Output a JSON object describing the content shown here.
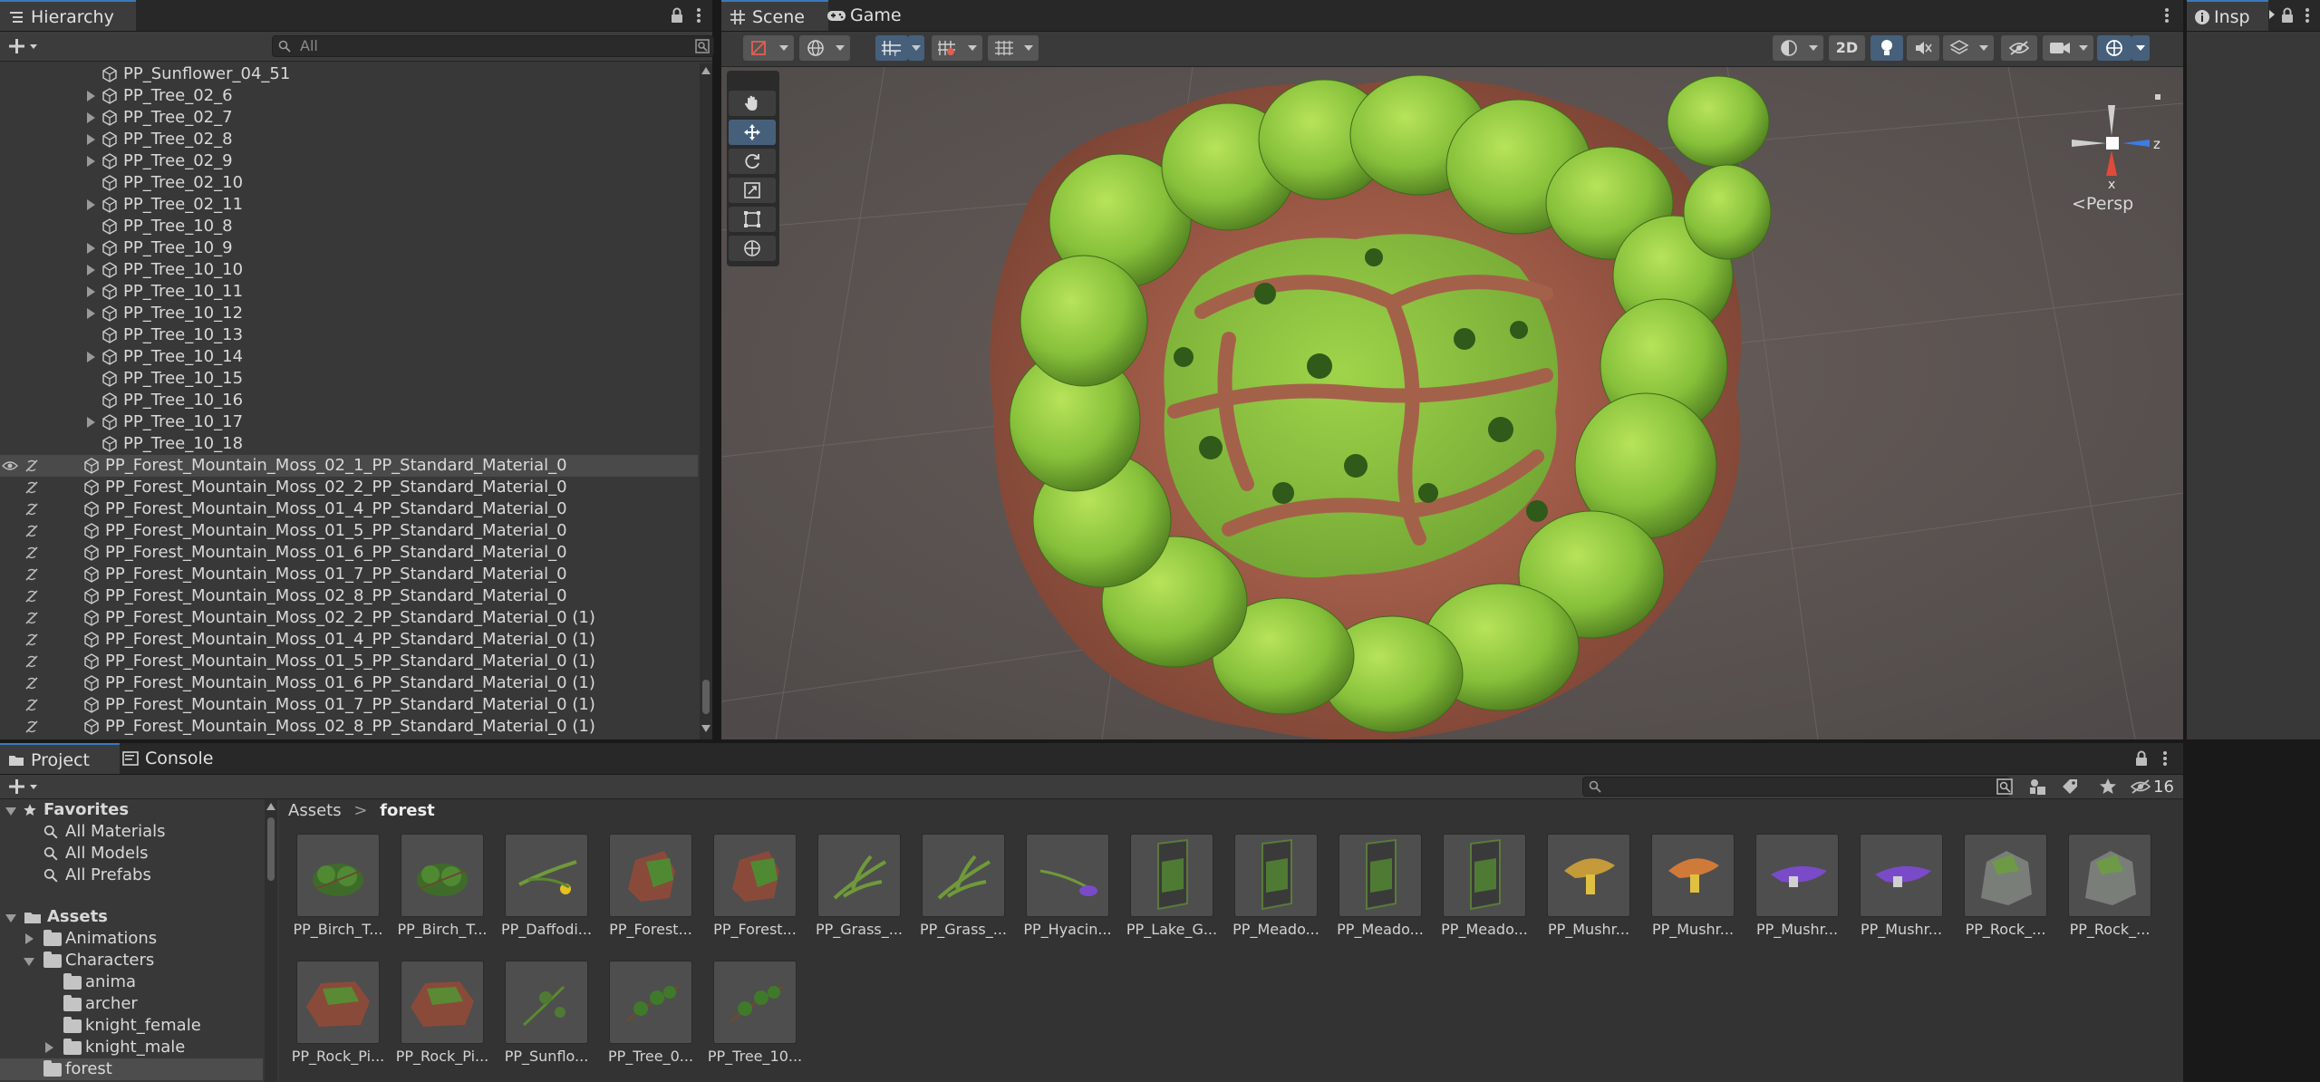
{
  "hierarchy": {
    "tab_label": "Hierarchy",
    "search_placeholder": "All",
    "rows": [
      {
        "label": "PP_Sunflower_04_51",
        "arrow": false,
        "top_level": false
      },
      {
        "label": "PP_Tree_02_6",
        "arrow": true,
        "top_level": false
      },
      {
        "label": "PP_Tree_02_7",
        "arrow": true,
        "top_level": false
      },
      {
        "label": "PP_Tree_02_8",
        "arrow": true,
        "top_level": false
      },
      {
        "label": "PP_Tree_02_9",
        "arrow": true,
        "top_level": false
      },
      {
        "label": "PP_Tree_02_10",
        "arrow": false,
        "top_level": false
      },
      {
        "label": "PP_Tree_02_11",
        "arrow": true,
        "top_level": false
      },
      {
        "label": "PP_Tree_10_8",
        "arrow": false,
        "top_level": false
      },
      {
        "label": "PP_Tree_10_9",
        "arrow": true,
        "top_level": false
      },
      {
        "label": "PP_Tree_10_10",
        "arrow": true,
        "top_level": false
      },
      {
        "label": "PP_Tree_10_11",
        "arrow": true,
        "top_level": false
      },
      {
        "label": "PP_Tree_10_12",
        "arrow": true,
        "top_level": false
      },
      {
        "label": "PP_Tree_10_13",
        "arrow": false,
        "top_level": false
      },
      {
        "label": "PP_Tree_10_14",
        "arrow": true,
        "top_level": false
      },
      {
        "label": "PP_Tree_10_15",
        "arrow": false,
        "top_level": false
      },
      {
        "label": "PP_Tree_10_16",
        "arrow": false,
        "top_level": false
      },
      {
        "label": "PP_Tree_10_17",
        "arrow": true,
        "top_level": false
      },
      {
        "label": "PP_Tree_10_18",
        "arrow": false,
        "top_level": false
      },
      {
        "label": "PP_Forest_Mountain_Moss_02_1_PP_Standard_Material_0",
        "arrow": false,
        "top_level": true,
        "selected": true
      },
      {
        "label": "PP_Forest_Mountain_Moss_02_2_PP_Standard_Material_0",
        "arrow": false,
        "top_level": true
      },
      {
        "label": "PP_Forest_Mountain_Moss_01_4_PP_Standard_Material_0",
        "arrow": false,
        "top_level": true
      },
      {
        "label": "PP_Forest_Mountain_Moss_01_5_PP_Standard_Material_0",
        "arrow": false,
        "top_level": true
      },
      {
        "label": "PP_Forest_Mountain_Moss_01_6_PP_Standard_Material_0",
        "arrow": false,
        "top_level": true
      },
      {
        "label": "PP_Forest_Mountain_Moss_01_7_PP_Standard_Material_0",
        "arrow": false,
        "top_level": true
      },
      {
        "label": "PP_Forest_Mountain_Moss_02_8_PP_Standard_Material_0",
        "arrow": false,
        "top_level": true
      },
      {
        "label": "PP_Forest_Mountain_Moss_02_2_PP_Standard_Material_0 (1)",
        "arrow": false,
        "top_level": true
      },
      {
        "label": "PP_Forest_Mountain_Moss_01_4_PP_Standard_Material_0 (1)",
        "arrow": false,
        "top_level": true
      },
      {
        "label": "PP_Forest_Mountain_Moss_01_5_PP_Standard_Material_0 (1)",
        "arrow": false,
        "top_level": true
      },
      {
        "label": "PP_Forest_Mountain_Moss_01_6_PP_Standard_Material_0 (1)",
        "arrow": false,
        "top_level": true
      },
      {
        "label": "PP_Forest_Mountain_Moss_01_7_PP_Standard_Material_0 (1)",
        "arrow": false,
        "top_level": true
      },
      {
        "label": "PP_Forest_Mountain_Moss_02_8_PP_Standard_Material_0 (1)",
        "arrow": false,
        "top_level": true
      }
    ]
  },
  "scene": {
    "tab_scene": "Scene",
    "tab_game": "Game",
    "btn_2d": "2D",
    "gizmo_persp": "Persp",
    "gizmo_axis_z": "z",
    "gizmo_axis_x": "x"
  },
  "inspector": {
    "tab_label": "Insp"
  },
  "project": {
    "tab_project": "Project",
    "tab_console": "Console",
    "hidden_count": "16",
    "breadcrumb_root": "Assets",
    "breadcrumb_current": "forest",
    "favorites_label": "Favorites",
    "favorites": [
      "All Materials",
      "All Models",
      "All Prefabs"
    ],
    "assets_label": "Assets",
    "folders": [
      {
        "label": "Animations",
        "depth": 1,
        "expand": "collapsed"
      },
      {
        "label": "Characters",
        "depth": 1,
        "expand": "expanded"
      },
      {
        "label": "anima",
        "depth": 2,
        "expand": "none"
      },
      {
        "label": "archer",
        "depth": 2,
        "expand": "none"
      },
      {
        "label": "knight_female",
        "depth": 2,
        "expand": "none"
      },
      {
        "label": "knight_male",
        "depth": 2,
        "expand": "collapsed"
      },
      {
        "label": "forest",
        "depth": 1,
        "expand": "none",
        "selected": true
      }
    ],
    "assets": [
      {
        "name": "PP_Birch_T...",
        "kind": "bush"
      },
      {
        "name": "PP_Birch_T...",
        "kind": "bush"
      },
      {
        "name": "PP_Daffodi...",
        "kind": "daffodil"
      },
      {
        "name": "PP_Forest...",
        "kind": "rockmoss"
      },
      {
        "name": "PP_Forest...",
        "kind": "rockmoss"
      },
      {
        "name": "PP_Grass_...",
        "kind": "grass"
      },
      {
        "name": "PP_Grass_...",
        "kind": "grass"
      },
      {
        "name": "PP_Hyacin...",
        "kind": "hyacinth"
      },
      {
        "name": "PP_Lake_G...",
        "kind": "panel"
      },
      {
        "name": "PP_Meado...",
        "kind": "panel"
      },
      {
        "name": "PP_Meado...",
        "kind": "panel"
      },
      {
        "name": "PP_Meado...",
        "kind": "panel"
      },
      {
        "name": "PP_Mushr...",
        "kind": "mushroom-yellow"
      },
      {
        "name": "PP_Mushr...",
        "kind": "mushroom-orange"
      },
      {
        "name": "PP_Mushr...",
        "kind": "mushroom-purple"
      },
      {
        "name": "PP_Mushr...",
        "kind": "mushroom-purple"
      },
      {
        "name": "PP_Rock_...",
        "kind": "rock"
      },
      {
        "name": "PP_Rock_...",
        "kind": "rock"
      },
      {
        "name": "PP_Rock_Pi...",
        "kind": "rockpile"
      },
      {
        "name": "PP_Rock_Pi...",
        "kind": "rockpile"
      },
      {
        "name": "PP_Sunflo...",
        "kind": "sunflower"
      },
      {
        "name": "PP_Tree_0...",
        "kind": "tree"
      },
      {
        "name": "PP_Tree_10...",
        "kind": "tree"
      }
    ]
  },
  "colors": {
    "selection_blue": "#3a79bb",
    "foliage_green": "#8cc63e",
    "cliff_brown": "#a55e46"
  }
}
